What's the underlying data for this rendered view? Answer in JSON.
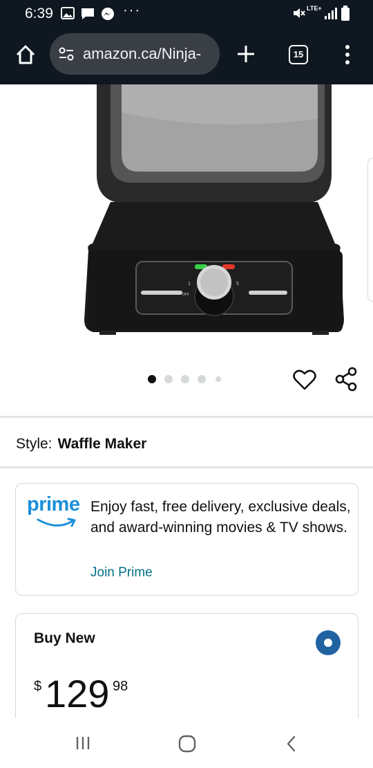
{
  "status_bar": {
    "time": "6:39",
    "network": "LTE+",
    "notification_icons": [
      "gallery-icon",
      "message-icon",
      "messenger-icon",
      "more-notifications-icon"
    ],
    "system_icons": [
      "mute-icon",
      "signal-icon",
      "battery-icon"
    ]
  },
  "browser": {
    "url": "amazon.ca/Ninja-",
    "tab_count": "15",
    "icons": [
      "home-icon",
      "site-settings-icon",
      "new-tab-icon",
      "menu-icon"
    ]
  },
  "product": {
    "image_alt": "Ninja waffle maker",
    "carousel": {
      "total_slides": 5,
      "active_slide": 1
    },
    "style_label": "Style:",
    "style_value": "Waffle Maker"
  },
  "prime": {
    "logo_text": "prime",
    "description": "Enjoy fast, free delivery, exclusive deals, and award-winning movies & TV shows.",
    "link": "Join Prime"
  },
  "buy_box": {
    "title": "Buy New",
    "selected": true,
    "price_symbol": "$",
    "price_whole": "129",
    "price_fraction": "98"
  },
  "nav_bar": {
    "icons": [
      "recent-apps-icon",
      "home-button-icon",
      "back-icon"
    ]
  },
  "colors": {
    "status_bar_bg": "#0f1720",
    "url_pill_bg": "#3a3f46",
    "prime_blue": "#1a8fd8",
    "link_teal": "#007185",
    "radio_blue": "#2162a1"
  }
}
